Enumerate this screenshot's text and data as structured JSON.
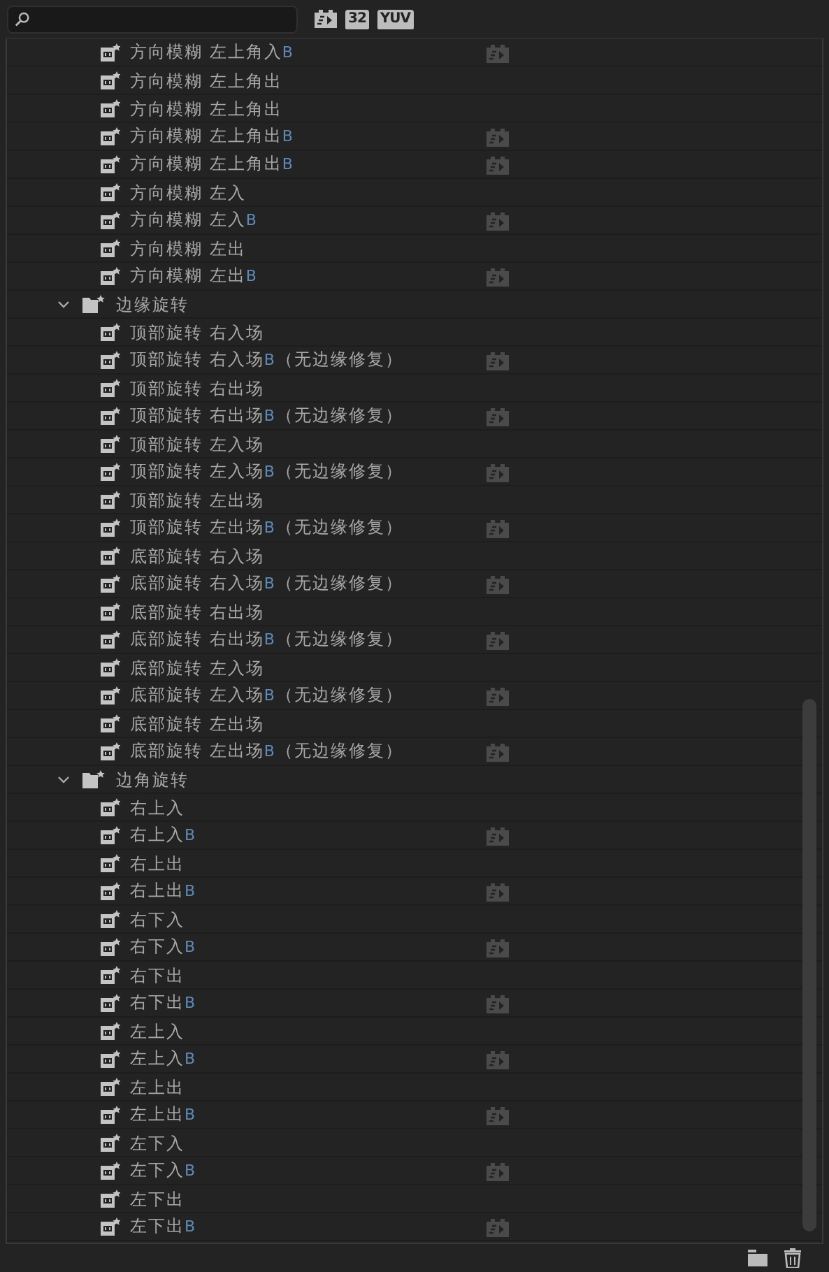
{
  "toolbar": [
    {
      "kind": "accelerated"
    },
    {
      "kind": "label",
      "label": "32"
    },
    {
      "kind": "label",
      "label": "YUV"
    }
  ],
  "effects": [
    {
      "kind": "item",
      "label": "方向模糊 左上角入",
      "suffix": "B",
      "accelerated": true
    },
    {
      "kind": "item",
      "label": "方向模糊 左上角出",
      "accelerated": false
    },
    {
      "kind": "item",
      "label": "方向模糊 左上角出",
      "accelerated": false
    },
    {
      "kind": "item",
      "label": "方向模糊 左上角出",
      "suffix": "B",
      "accelerated": true
    },
    {
      "kind": "item",
      "label": "方向模糊 左上角出",
      "suffix": "B",
      "accelerated": true
    },
    {
      "kind": "item",
      "label": "方向模糊 左入",
      "accelerated": false
    },
    {
      "kind": "item",
      "label": "方向模糊 左入",
      "suffix": "B",
      "accelerated": true
    },
    {
      "kind": "item",
      "label": "方向模糊 左出",
      "accelerated": false
    },
    {
      "kind": "item",
      "label": "方向模糊 左出",
      "suffix": "B",
      "accelerated": true
    },
    {
      "kind": "folder",
      "label": "边缘旋转",
      "expanded": true,
      "children": [
        {
          "kind": "item",
          "label": "顶部旋转 右入场",
          "accelerated": false
        },
        {
          "kind": "item",
          "label": "顶部旋转 右入场",
          "suffix": "B",
          "note": "（无边缘修复）",
          "accelerated": true
        },
        {
          "kind": "item",
          "label": "顶部旋转 右出场",
          "accelerated": false
        },
        {
          "kind": "item",
          "label": "顶部旋转 右出场",
          "suffix": "B",
          "note": "（无边缘修复）",
          "accelerated": true
        },
        {
          "kind": "item",
          "label": "顶部旋转 左入场",
          "accelerated": false
        },
        {
          "kind": "item",
          "label": "顶部旋转 左入场",
          "suffix": "B",
          "note": "（无边缘修复）",
          "accelerated": true
        },
        {
          "kind": "item",
          "label": "顶部旋转 左出场",
          "accelerated": false
        },
        {
          "kind": "item",
          "label": "顶部旋转 左出场",
          "suffix": "B",
          "note": "（无边缘修复）",
          "accelerated": true
        },
        {
          "kind": "item",
          "label": "底部旋转 右入场",
          "accelerated": false
        },
        {
          "kind": "item",
          "label": "底部旋转 右入场",
          "suffix": "B",
          "note": "（无边缘修复）",
          "accelerated": true
        },
        {
          "kind": "item",
          "label": "底部旋转 右出场",
          "accelerated": false
        },
        {
          "kind": "item",
          "label": "底部旋转 右出场",
          "suffix": "B",
          "note": "（无边缘修复）",
          "accelerated": true
        },
        {
          "kind": "item",
          "label": "底部旋转 左入场",
          "accelerated": false
        },
        {
          "kind": "item",
          "label": "底部旋转 左入场",
          "suffix": "B",
          "note": "（无边缘修复）",
          "accelerated": true
        },
        {
          "kind": "item",
          "label": "底部旋转 左出场",
          "accelerated": false
        },
        {
          "kind": "item",
          "label": "底部旋转 左出场",
          "suffix": "B",
          "note": "（无边缘修复）",
          "accelerated": true
        }
      ]
    },
    {
      "kind": "folder",
      "label": "边角旋转",
      "expanded": true,
      "children": [
        {
          "kind": "item",
          "label": "右上入",
          "accelerated": false
        },
        {
          "kind": "item",
          "label": "右上入",
          "suffix": "B",
          "accelerated": true
        },
        {
          "kind": "item",
          "label": "右上出",
          "accelerated": false
        },
        {
          "kind": "item",
          "label": "右上出",
          "suffix": "B",
          "accelerated": true
        },
        {
          "kind": "item",
          "label": "右下入",
          "accelerated": false
        },
        {
          "kind": "item",
          "label": "右下入",
          "suffix": "B",
          "accelerated": true
        },
        {
          "kind": "item",
          "label": "右下出",
          "accelerated": false
        },
        {
          "kind": "item",
          "label": "右下出",
          "suffix": "B",
          "accelerated": true
        },
        {
          "kind": "item",
          "label": "左上入",
          "accelerated": false
        },
        {
          "kind": "item",
          "label": "左上入",
          "suffix": "B",
          "accelerated": true
        },
        {
          "kind": "item",
          "label": "左上出",
          "accelerated": false
        },
        {
          "kind": "item",
          "label": "左上出",
          "suffix": "B",
          "accelerated": true
        },
        {
          "kind": "item",
          "label": "左下入",
          "accelerated": false
        },
        {
          "kind": "item",
          "label": "左下入",
          "suffix": "B",
          "accelerated": true
        },
        {
          "kind": "item",
          "label": "左下出",
          "accelerated": false
        },
        {
          "kind": "item",
          "label": "左下出",
          "suffix": "B",
          "accelerated": true
        }
      ]
    }
  ]
}
